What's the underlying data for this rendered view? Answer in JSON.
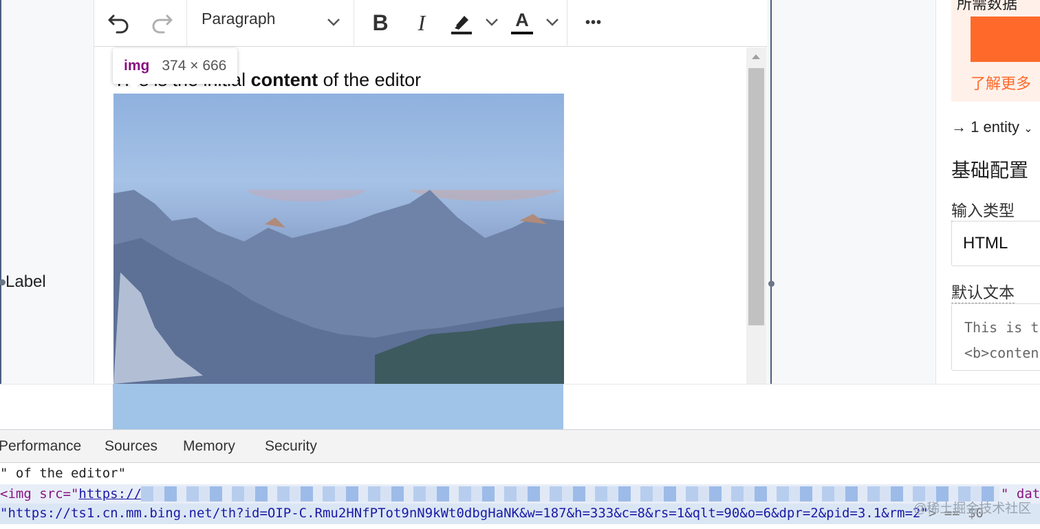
{
  "toolbar": {
    "block_format": "Paragraph",
    "bold_label": "B",
    "italic_label": "I",
    "font_color_label": "A",
    "more_label": "•••"
  },
  "editor": {
    "text_before": "This is the initial ",
    "text_bold": "content",
    "text_after": " of the editor"
  },
  "inspector_tooltip": {
    "tag": "img",
    "dimensions": "374 × 666"
  },
  "canvas": {
    "side_label": "Label"
  },
  "right_panel": {
    "promo_top_text": "所需数据",
    "promo_link": "了解更多",
    "entity_text": "→ 1 entity",
    "section_title": "基础配置",
    "input_type_label": "输入类型",
    "input_type_value": "HTML",
    "default_text_label": "默认文本",
    "default_text_line1": "This is t",
    "default_text_line2": "<b>conten"
  },
  "devtools": {
    "tabs": [
      "Performance",
      "Sources",
      "Memory",
      "Security"
    ],
    "line1": "\" of the editor\"",
    "line2_tag": "<img src=\"",
    "line2_link": "https://",
    "line2_end": "\" dat",
    "line3_url": "\"https://ts1.cn.mm.bing.net/th?id=OIP-C.Rmu2HNfPTot9nN9kWt0dbgHaNK&w=187&h=333&c=8&rs=1&qlt=90&o=6&dpr=2&pid=3.1&rm=2\"",
    "line3_tail": "> == $0",
    "watermark": "@稀土掘金技术社区"
  }
}
